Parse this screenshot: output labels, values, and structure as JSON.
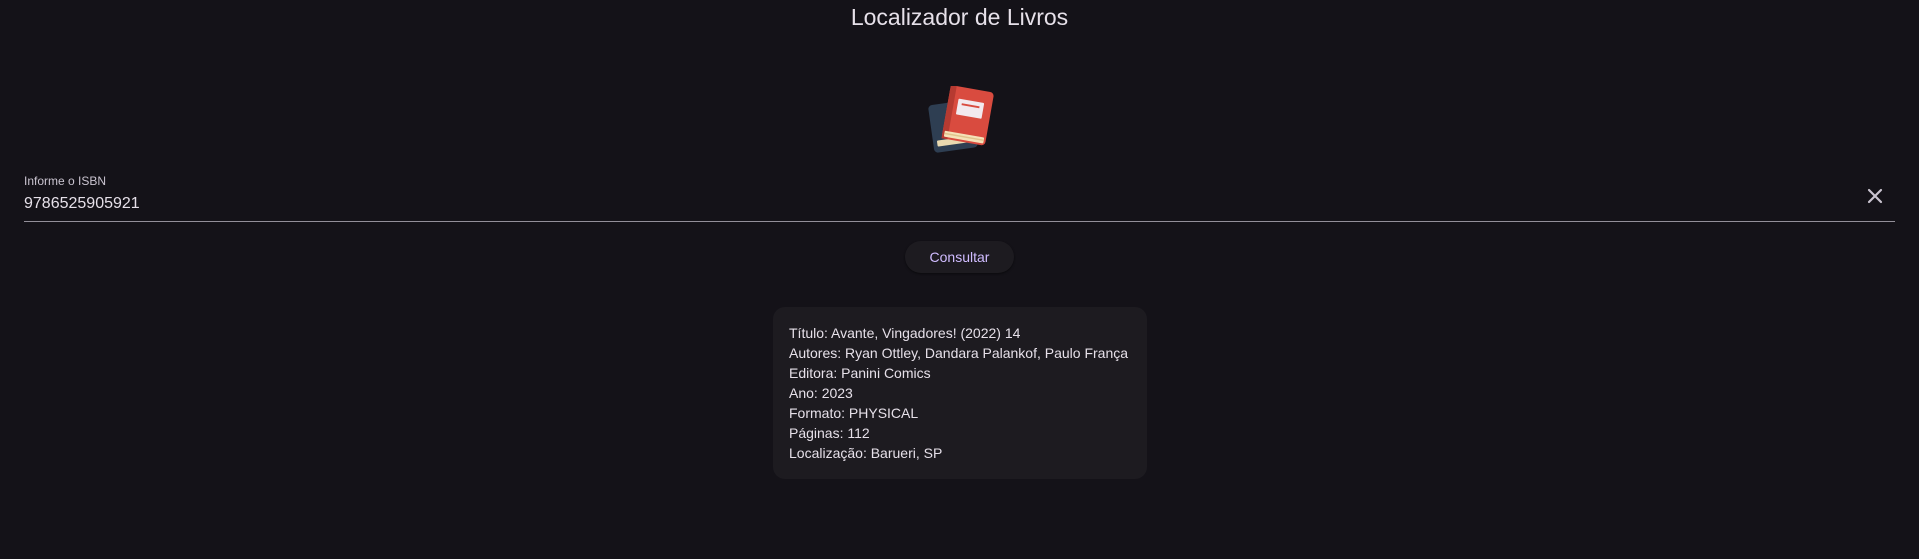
{
  "app": {
    "title": "Localizador de Livros"
  },
  "logo": {
    "icon": "books-icon"
  },
  "isbn_field": {
    "label": "Informe o ISBN",
    "value": "9786525905921",
    "clear_icon": "close-icon"
  },
  "consult_button": {
    "label": "Consultar"
  },
  "result": {
    "lines": [
      "Título: Avante, Vingadores! (2022) 14",
      "Autores: Ryan Ottley, Dandara Palankof, Paulo França",
      "Editora: Panini Comics",
      "Ano: 2023",
      "Formato: PHYSICAL",
      "Páginas: 112",
      "Localização: Barueri, SP"
    ]
  },
  "colors": {
    "background": "#141218",
    "surface": "#1d1b20",
    "accent": "#d0bcff",
    "text": "#e6e0e9",
    "book_red": "#d94b3f",
    "book_dark": "#2e3e52"
  }
}
